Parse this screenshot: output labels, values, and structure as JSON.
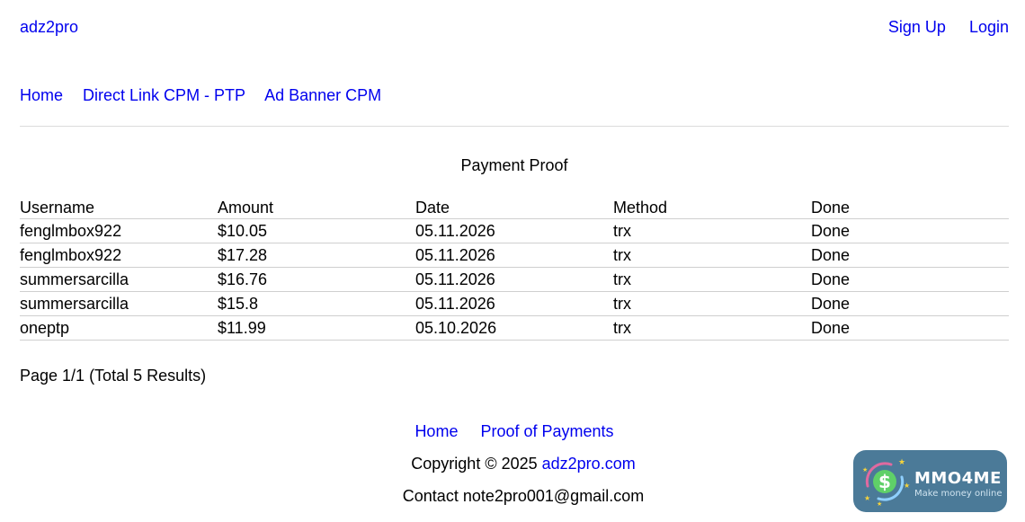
{
  "header": {
    "brand": "adz2pro",
    "auth": [
      {
        "label": "Sign Up"
      },
      {
        "label": "Login"
      }
    ]
  },
  "nav": [
    {
      "label": "Home"
    },
    {
      "label": "Direct Link CPM - PTP"
    },
    {
      "label": "Ad Banner CPM"
    }
  ],
  "proof": {
    "title": "Payment Proof",
    "columns": [
      "Username",
      "Amount",
      "Date",
      "Method",
      "Done"
    ],
    "rows": [
      [
        "fenglmbox922",
        "$10.05",
        "05.11.2026",
        "trx",
        "Done"
      ],
      [
        "fenglmbox922",
        "$17.28",
        "05.11.2026",
        "trx",
        "Done"
      ],
      [
        "summersarcilla",
        "$16.76",
        "05.11.2026",
        "trx",
        "Done"
      ],
      [
        "summersarcilla",
        "$15.8",
        "05.11.2026",
        "trx",
        "Done"
      ],
      [
        "oneptp",
        "$11.99",
        "05.10.2026",
        "trx",
        "Done"
      ]
    ],
    "pager": "Page 1/1 (Total 5 Results)"
  },
  "footer": {
    "links": [
      {
        "label": "Home"
      },
      {
        "label": "Proof of Payments"
      }
    ],
    "copyright_prefix": "Copyright © 2025",
    "copyright_link": "adz2pro.com",
    "contact": "Contact note2pro001@gmail.com"
  },
  "badge": {
    "name": "MMO4ME",
    "tagline": "Make money online",
    "icon": "dollar-coin-icon",
    "colors": {
      "background": "#4b7a98",
      "coin": "#5fd068",
      "stars": "#f5d33b"
    }
  },
  "colors": {
    "link": "#0000ee",
    "divider": "#dcdcdc"
  }
}
